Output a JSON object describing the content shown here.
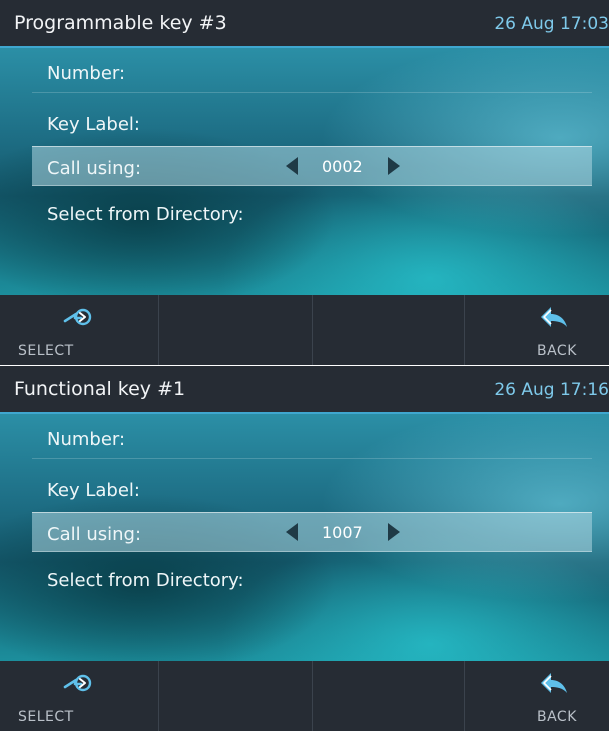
{
  "screens": [
    {
      "title": "Programmable key #3",
      "clock": "26 Aug 17:03",
      "rows": {
        "number_label": "Number:",
        "key_label_label": "Key Label:",
        "call_using_label": "Call using:",
        "call_using_value": "0002",
        "directory_label": "Select from Directory:"
      },
      "softkeys": {
        "select_label": "SELECT",
        "select_icon": "select-arrow-icon",
        "back_label": "BACK",
        "back_icon": "back-arrow-icon"
      }
    },
    {
      "title": "Functional key #1",
      "clock": "26 Aug 17:16",
      "rows": {
        "number_label": "Number:",
        "key_label_label": "Key Label:",
        "call_using_label": "Call using:",
        "call_using_value": "1007",
        "directory_label": "Select from Directory:"
      },
      "softkeys": {
        "select_label": "SELECT",
        "select_icon": "select-arrow-icon",
        "back_label": "BACK",
        "back_icon": "back-arrow-icon"
      }
    }
  ],
  "colors": {
    "titlebar_bg": "#262c34",
    "accent": "#3fa7cf",
    "clock_text": "#7ec9ea",
    "softkey_bg": "#262c34"
  }
}
